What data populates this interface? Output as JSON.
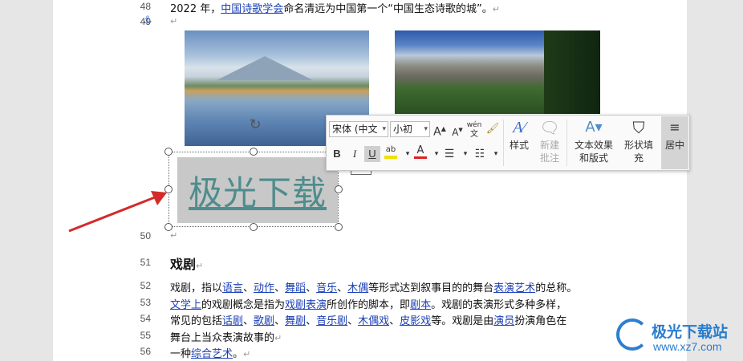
{
  "document": {
    "lines": [
      {
        "num": "48",
        "segments": [
          {
            "text": "2022 年，",
            "link": false
          },
          {
            "text": "中国诗歌学会",
            "link": true
          },
          {
            "text": "命名清远为中国第一个“中国生态诗歌的城”。",
            "link": false
          },
          {
            "text": "↵",
            "mark": true
          }
        ]
      },
      {
        "num": "49",
        "segments": [
          {
            "text": "↵",
            "mark": true
          }
        ]
      },
      {
        "num": "50",
        "segments": [
          {
            "text": "↵",
            "mark": true
          }
        ]
      },
      {
        "num": "51",
        "heading": "戏剧",
        "mark": "↵"
      },
      {
        "num": "52",
        "segments": [
          {
            "text": "戏剧，指以",
            "link": false
          },
          {
            "text": "语言",
            "link": true
          },
          {
            "text": "、",
            "link": false
          },
          {
            "text": "动作",
            "link": true
          },
          {
            "text": "、",
            "link": false
          },
          {
            "text": "舞蹈",
            "link": true
          },
          {
            "text": "、",
            "link": false
          },
          {
            "text": "音乐",
            "link": true
          },
          {
            "text": "、",
            "link": false
          },
          {
            "text": "木偶",
            "link": true
          },
          {
            "text": "等形式达到叙事目的的舞台",
            "link": false
          },
          {
            "text": "表演艺术",
            "link": true
          },
          {
            "text": "的总称。",
            "link": false
          }
        ]
      },
      {
        "num": "53",
        "segments": [
          {
            "text": "文学上",
            "link": true
          },
          {
            "text": "的戏剧概念是指为",
            "link": false
          },
          {
            "text": "戏剧表演",
            "link": true
          },
          {
            "text": "所创作的脚本，即",
            "link": false
          },
          {
            "text": "剧本",
            "link": true
          },
          {
            "text": "。戏剧的表演形式多种多样，",
            "link": false
          }
        ]
      },
      {
        "num": "54",
        "segments": [
          {
            "text": "常见的包括",
            "link": false
          },
          {
            "text": "话剧",
            "link": true
          },
          {
            "text": "、",
            "link": false
          },
          {
            "text": "歌剧",
            "link": true
          },
          {
            "text": "、",
            "link": false
          },
          {
            "text": "舞剧",
            "link": true
          },
          {
            "text": "、",
            "link": false
          },
          {
            "text": "音乐剧",
            "link": true
          },
          {
            "text": "、",
            "link": false
          },
          {
            "text": "木偶戏",
            "link": true
          },
          {
            "text": "、",
            "link": false
          },
          {
            "text": "皮影戏",
            "link": true
          },
          {
            "text": "等。戏剧是由",
            "link": false
          },
          {
            "text": "演员",
            "link": true
          },
          {
            "text": "扮演角色在",
            "link": false
          }
        ]
      },
      {
        "num": "55",
        "segments": [
          {
            "text": "舞台上当众表演故事的",
            "link": false
          },
          {
            "text": "↵",
            "mark": true
          }
        ]
      },
      {
        "num": "56",
        "segments": [
          {
            "text": "一种",
            "link": false
          },
          {
            "text": "综合艺术",
            "link": true
          },
          {
            "text": "。",
            "link": false
          },
          {
            "text": "↵",
            "mark": true
          }
        ]
      }
    ]
  },
  "textbox": {
    "text": "极光下载"
  },
  "toolbar": {
    "font_name": "宋体 (中文",
    "font_size": "小初",
    "grow_font_icon": "A",
    "shrink_font_icon": "A",
    "pinyin_icon": "wén",
    "bold": "B",
    "italic": "I",
    "underline": "U",
    "highlight_icon": "ab",
    "font_color_icon": "A",
    "styles_label": "样式",
    "new_comment_label_1": "新建",
    "new_comment_label_2": "批注",
    "text_effects_label_1": "文本效果",
    "text_effects_label_2": "和版式",
    "shape_fill_label_1": "形状填",
    "shape_fill_label_2": "充",
    "center_label": "居中"
  },
  "watermark": {
    "title": "极光下载站",
    "url": "www.xz7.com"
  },
  "colors": {
    "link": "#1a3fb5",
    "wordart": "#4f8c8c",
    "arrow": "#d42a2a",
    "highlight": "#f2e000",
    "font_color_bar": "#e02020",
    "watermark": "#2a7ccc"
  }
}
